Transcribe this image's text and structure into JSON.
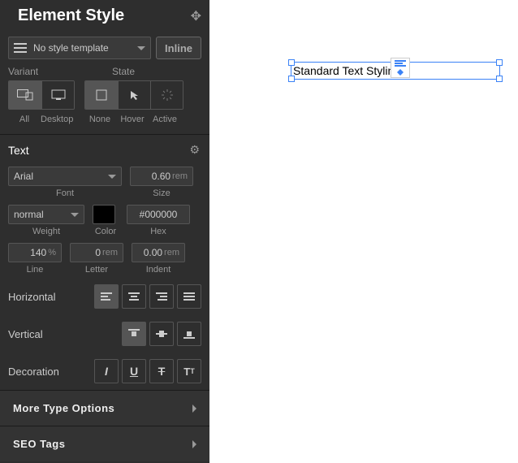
{
  "header": {
    "title": "Element Style"
  },
  "template": {
    "selected": "No style template",
    "inline_btn": "Inline"
  },
  "variant": {
    "label": "Variant",
    "options": [
      "All",
      "Desktop"
    ],
    "active": "All"
  },
  "state": {
    "label": "State",
    "options": [
      "None",
      "Hover",
      "Active"
    ],
    "active": "None"
  },
  "text_section": {
    "title": "Text",
    "font": {
      "value": "Arial",
      "label": "Font"
    },
    "size": {
      "value": "0.60",
      "unit": "rem",
      "label": "Size"
    },
    "weight": {
      "value": "normal",
      "label": "Weight"
    },
    "color": {
      "swatch": "#000000",
      "hex": "#000000",
      "label_color": "Color",
      "label_hex": "Hex"
    },
    "line": {
      "value": "140",
      "unit": "%",
      "label": "Line"
    },
    "letter": {
      "value": "0",
      "unit": "rem",
      "label": "Letter"
    },
    "indent": {
      "value": "0.00",
      "unit": "rem",
      "label": "Indent"
    },
    "horizontal": {
      "label": "Horizontal"
    },
    "vertical": {
      "label": "Vertical"
    },
    "decoration": {
      "label": "Decoration"
    }
  },
  "accordions": {
    "more_type": "More Type Options",
    "seo_tags": "SEO Tags"
  },
  "canvas": {
    "element_text": "Standard Text Styling"
  }
}
